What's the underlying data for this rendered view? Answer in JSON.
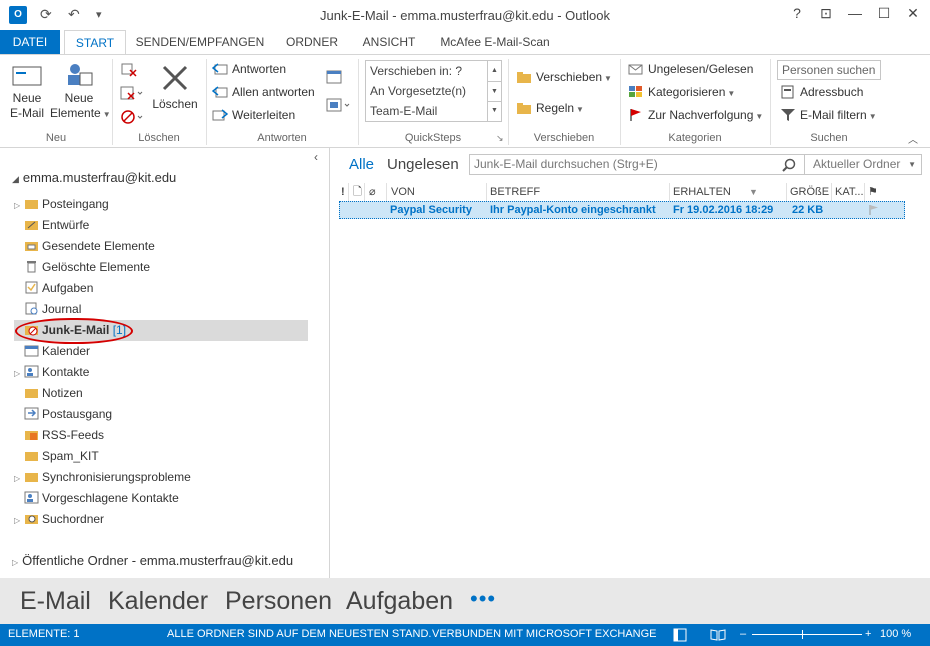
{
  "window": {
    "title": "Junk-E-Mail - emma.musterfrau@kit.edu - Outlook",
    "app_icon_label": "O",
    "help": "?",
    "restore_ribbon": "⊡",
    "minimize": "—",
    "maximize": "☐",
    "close": "✕"
  },
  "quick_access": {
    "send_receive": "⟳",
    "undo": "↶",
    "customize": "▾"
  },
  "ribbon_tabs": [
    "DATEI",
    "START",
    "SENDEN/EMPFANGEN",
    "ORDNER",
    "ANSICHT",
    "McAfee E-Mail-Scan"
  ],
  "ribbon": {
    "neu": {
      "label": "Neu",
      "new_email_1": "Neue",
      "new_email_2": "E-Mail",
      "new_items_1": "Neue",
      "new_items_2": "Elemente"
    },
    "loeschen": {
      "label": "Löschen",
      "delete": "Löschen"
    },
    "antworten": {
      "label": "Antworten",
      "reply": "Antworten",
      "reply_all": "Allen antworten",
      "forward": "Weiterleiten"
    },
    "quicksteps": {
      "label": "QuickSteps",
      "items": [
        "Verschieben in: ?",
        "An Vorgesetzte(n)",
        "Team-E-Mail"
      ]
    },
    "verschieben": {
      "label": "Verschieben",
      "move": "Verschieben",
      "rules": "Regeln"
    },
    "kategorien": {
      "label": "Kategorien",
      "unread_read": "Ungelesen/Gelesen",
      "categorize": "Kategorisieren",
      "follow_up": "Zur Nachverfolgung"
    },
    "suchen": {
      "label": "Suchen",
      "search_people_placeholder": "Personen suchen",
      "address_book": "Adressbuch",
      "filter_email": "E-Mail filtern"
    }
  },
  "folder_pane": {
    "account": "emma.musterfrau@kit.edu",
    "folders": [
      {
        "name": "Posteingang",
        "expandable": true
      },
      {
        "name": "Entwürfe",
        "expandable": false
      },
      {
        "name": "Gesendete Elemente",
        "expandable": false
      },
      {
        "name": "Gelöschte Elemente",
        "expandable": false
      },
      {
        "name": "Aufgaben",
        "expandable": false
      },
      {
        "name": "Journal",
        "expandable": false
      },
      {
        "name": "Junk-E-Mail",
        "count": "[1]",
        "selected": true,
        "expandable": false
      },
      {
        "name": "Kalender",
        "expandable": false
      },
      {
        "name": "Kontakte",
        "expandable": true
      },
      {
        "name": "Notizen",
        "expandable": false
      },
      {
        "name": "Postausgang",
        "expandable": false
      },
      {
        "name": "RSS-Feeds",
        "expandable": false
      },
      {
        "name": "Spam_KIT",
        "expandable": false
      },
      {
        "name": "Synchronisierungsprobleme",
        "expandable": true
      },
      {
        "name": "Vorgeschlagene Kontakte",
        "expandable": false
      },
      {
        "name": "Suchordner",
        "expandable": true
      }
    ],
    "public_folders": "Öffentliche Ordner - emma.musterfrau@kit.edu"
  },
  "mail_list": {
    "filter_all": "Alle",
    "filter_unread": "Ungelesen",
    "search_placeholder": "Junk-E-Mail durchsuchen (Strg+E)",
    "search_scope": "Aktueller Ordner",
    "columns": {
      "importance": "!",
      "icon": "🗋",
      "attachment": "⌀",
      "from": "VON",
      "subject": "BETREFF",
      "received": "ERHALTEN",
      "size": "GRÖßE",
      "category": "KAT...",
      "flag": "⚑"
    },
    "messages": [
      {
        "from": "Paypal Security",
        "subject": "Ihr Paypal-Konto eingeschrankt",
        "received": "Fr 19.02.2016 18:29",
        "size": "22 KB"
      }
    ]
  },
  "nav_bar": [
    "E-Mail",
    "Kalender",
    "Personen",
    "Aufgaben"
  ],
  "nav_more": "•••",
  "status_bar": {
    "items": "ELEMENTE: 1",
    "sync": "ALLE ORDNER SIND AUF DEM NEUESTEN STAND.",
    "connection": "VERBUNDEN MIT MICROSOFT EXCHANGE",
    "zoom": "100 %"
  },
  "colors": {
    "accent": "#0072c6",
    "selection": "#cde6f7",
    "highlight_circle": "#d40000"
  }
}
